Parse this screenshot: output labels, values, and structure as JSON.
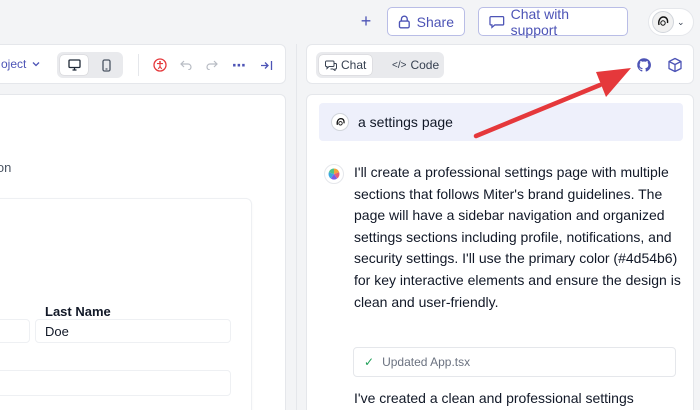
{
  "header": {
    "share_label": "Share",
    "support_label": "Chat with support"
  },
  "left_toolbar": {
    "project_label": "oject"
  },
  "left_panel": {
    "subtitle_fragment": "ion",
    "last_name_label": "Last Name",
    "last_name_value": "Doe"
  },
  "right_header": {
    "tabs": [
      {
        "label": "Chat",
        "active": true
      },
      {
        "label": "Code",
        "active": false
      }
    ]
  },
  "chat": {
    "user_message": "a settings page",
    "assistant_message": "I'll create a professional settings page with multiple sections that follows Miter's brand guidelines. The page will have a sidebar navigation and organized settings sections including profile, notifications, and security settings. I'll use the primary color (#4d54b6) for key interactive elements and ensure the design is clean and user-friendly.",
    "update_status": "Updated App.tsx",
    "assistant_message_2": "I've created a clean and professional settings"
  },
  "colors": {
    "accent": "#4d54b6",
    "annotation_arrow": "#e5383b",
    "success": "#22a05a"
  }
}
